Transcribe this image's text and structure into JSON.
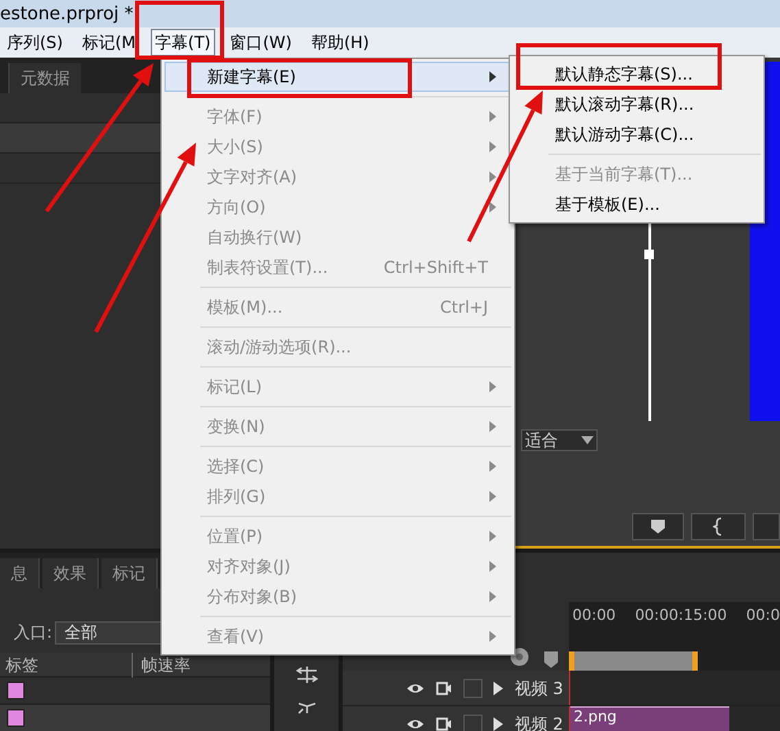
{
  "window": {
    "title": "estone.prproj *"
  },
  "menu_bar": [
    {
      "label": "序列(S)",
      "selected": false
    },
    {
      "label": "标记(M",
      "selected": false
    },
    {
      "label": "字幕(T)",
      "selected": true
    },
    {
      "label": "窗口(W)",
      "selected": false
    },
    {
      "label": "帮助(H)",
      "selected": false
    }
  ],
  "title_menu": {
    "groups": [
      [
        {
          "label": "新建字幕(E)",
          "submenu": true,
          "disabled": false,
          "selected": true
        }
      ],
      [
        {
          "label": "字体(F)",
          "submenu": true,
          "disabled": true,
          "selected": false
        },
        {
          "label": "大小(S)",
          "submenu": true,
          "disabled": true,
          "selected": false
        },
        {
          "label": "文字对齐(A)",
          "submenu": true,
          "disabled": true,
          "selected": false
        },
        {
          "label": "方向(O)",
          "submenu": true,
          "disabled": true,
          "selected": false
        },
        {
          "label": "自动换行(W)",
          "submenu": false,
          "disabled": true,
          "selected": false
        },
        {
          "label": "制表符设置(T)...",
          "shortcut": "Ctrl+Shift+T",
          "submenu": false,
          "disabled": true,
          "selected": false
        }
      ],
      [
        {
          "label": "模板(M)...",
          "shortcut": "Ctrl+J",
          "submenu": false,
          "disabled": true,
          "selected": false
        }
      ],
      [
        {
          "label": "滚动/游动选项(R)...",
          "submenu": false,
          "disabled": true,
          "selected": false
        }
      ],
      [
        {
          "label": "标记(L)",
          "submenu": true,
          "disabled": true,
          "selected": false
        }
      ],
      [
        {
          "label": "变换(N)",
          "submenu": true,
          "disabled": true,
          "selected": false
        }
      ],
      [
        {
          "label": "选择(C)",
          "submenu": true,
          "disabled": true,
          "selected": false
        },
        {
          "label": "排列(G)",
          "submenu": true,
          "disabled": true,
          "selected": false
        }
      ],
      [
        {
          "label": "位置(P)",
          "submenu": true,
          "disabled": true,
          "selected": false
        },
        {
          "label": "对齐对象(J)",
          "submenu": true,
          "disabled": true,
          "selected": false
        },
        {
          "label": "分布对象(B)",
          "submenu": true,
          "disabled": true,
          "selected": false
        }
      ],
      [
        {
          "label": "查看(V)",
          "submenu": true,
          "disabled": true,
          "selected": false
        }
      ]
    ]
  },
  "new_title_submenu": {
    "groups": [
      [
        {
          "label": "默认静态字幕(S)...",
          "disabled": false
        },
        {
          "label": "默认滚动字幕(R)...",
          "disabled": false
        },
        {
          "label": "默认游动字幕(C)...",
          "disabled": false
        }
      ],
      [
        {
          "label": "基于当前字幕(T)...",
          "disabled": true
        },
        {
          "label": "基于模板(E)...",
          "disabled": false
        }
      ]
    ]
  },
  "top_left_panel": {
    "tabs": [
      "元数据"
    ]
  },
  "monitor": {
    "zoom_dropdown": "适合"
  },
  "bottom_left_panel": {
    "tabs": [
      "息",
      "效果",
      "标记"
    ],
    "in_point_label": "入口:",
    "in_point_value": "全部",
    "columns": [
      "标签",
      "帧速率"
    ]
  },
  "timeline": {
    "ruler": [
      "00:00",
      "00:00:15:00",
      "00:0"
    ],
    "tracks": [
      {
        "name": "视频 3"
      },
      {
        "name": "视频 2",
        "clip": "2.png"
      }
    ]
  }
}
